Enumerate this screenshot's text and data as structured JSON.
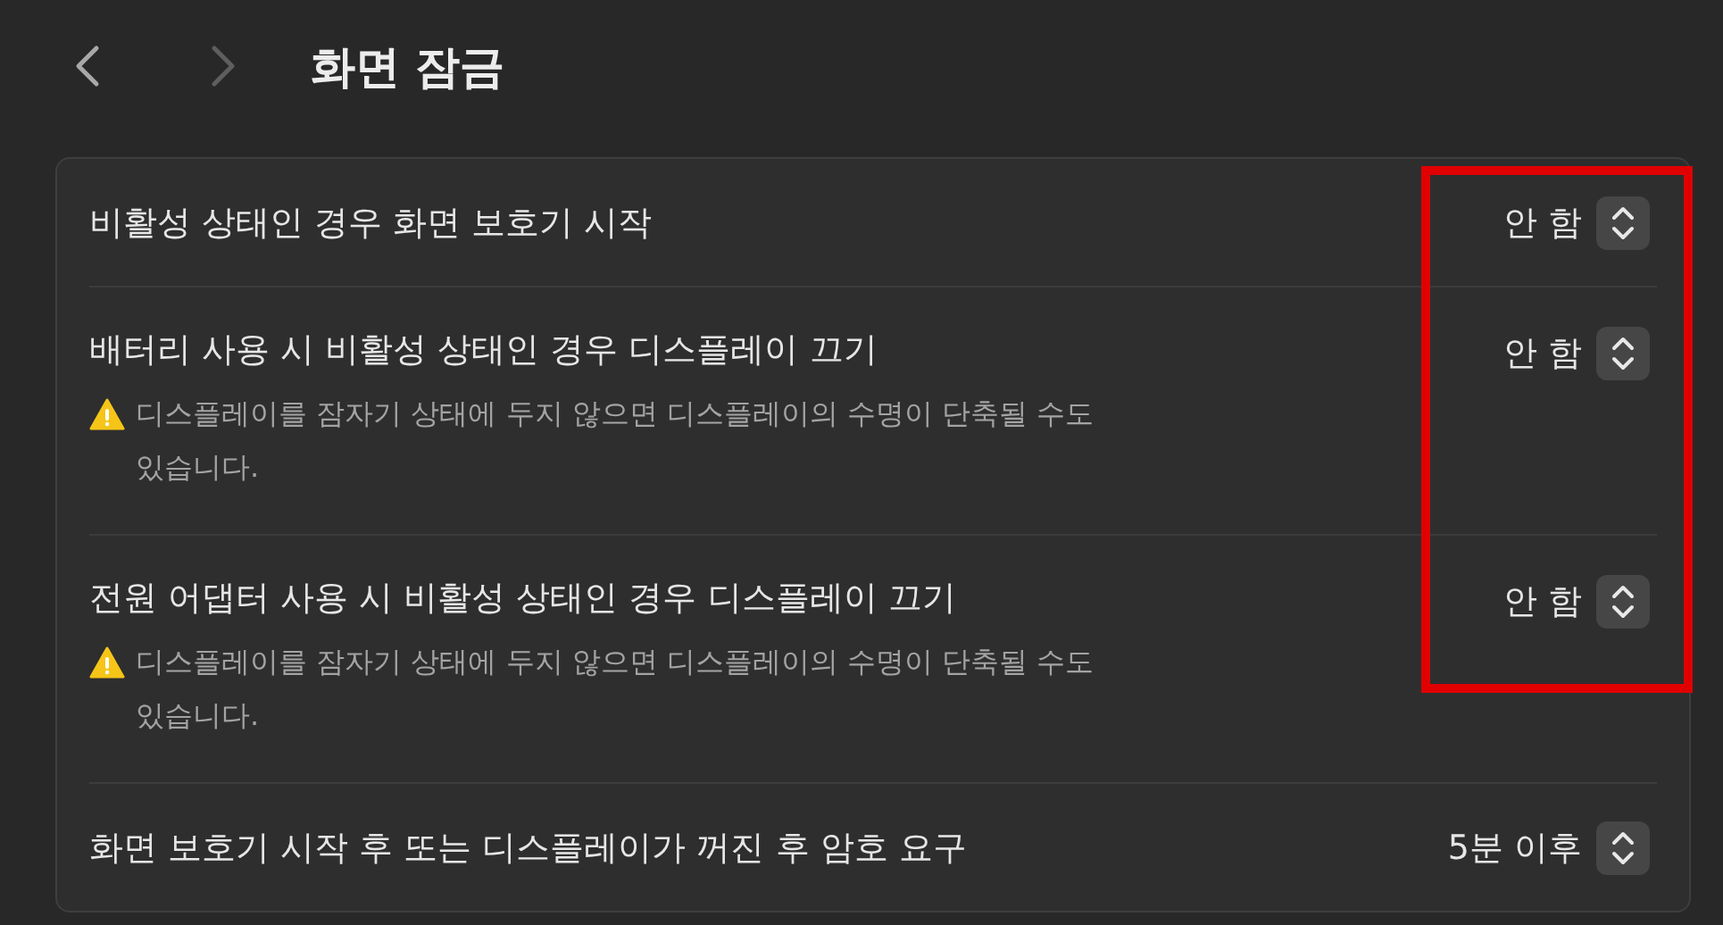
{
  "toolbar": {
    "back": {
      "disabled": false
    },
    "forward": {
      "disabled": true
    },
    "title": "화면 잠금"
  },
  "rows": [
    {
      "label": "비활성 상태인 경우 화면 보호기 시작",
      "value": "안 함",
      "highlighted": true
    },
    {
      "label": "배터리 사용 시 비활성 상태인 경우 디스플레이 끄기",
      "warning": "디스플레이를 잠자기 상태에 두지 않으면 디스플레이의 수명이 단축될 수도 있습니다.",
      "value": "안 함",
      "highlighted": true
    },
    {
      "label": "전원 어댑터 사용 시 비활성 상태인 경우 디스플레이 끄기",
      "warning": "디스플레이를 잠자기 상태에 두지 않으면 디스플레이의 수명이 단축될 수도 있습니다.",
      "value": "안 함",
      "highlighted": true
    },
    {
      "label": "화면 보호기 시작 후 또는 디스플레이가 꺼진 후 암호 요구",
      "value": "5분 이후",
      "highlighted": false
    }
  ]
}
